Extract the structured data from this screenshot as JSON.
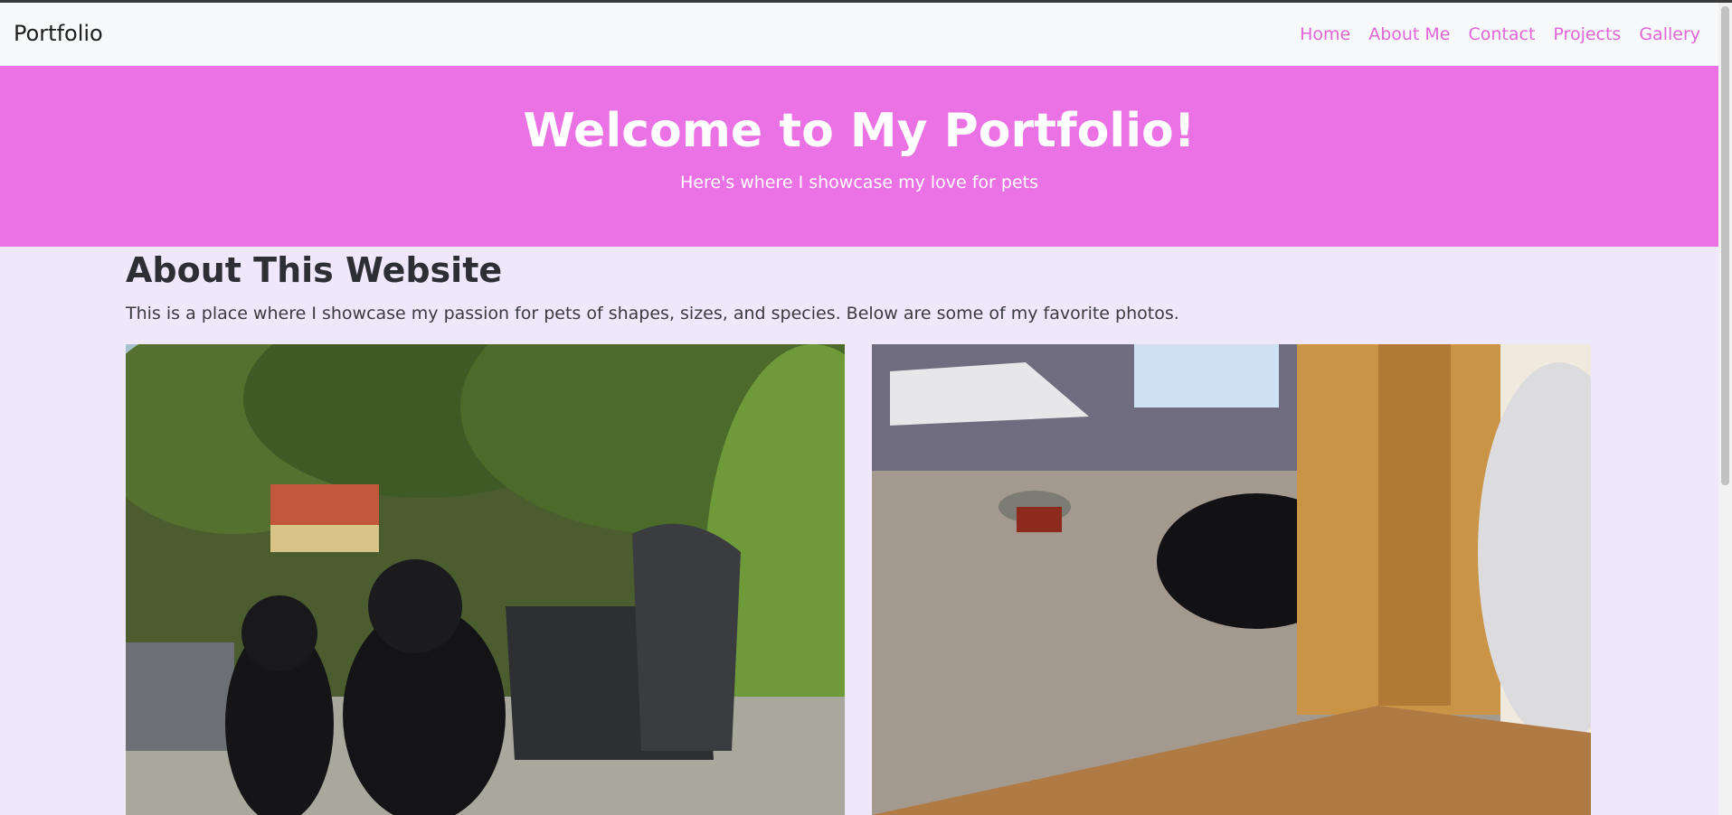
{
  "navbar": {
    "brand": "Portfolio",
    "links": [
      "Home",
      "About Me",
      "Contact",
      "Projects",
      "Gallery"
    ]
  },
  "hero": {
    "title": "Welcome to My Portfolio!",
    "subtitle": "Here's where I showcase my love for pets"
  },
  "about": {
    "title": "About This Website",
    "text": "This is a place where I showcase my passion for pets of shapes, sizes, and species. Below are some of my favorite photos."
  },
  "colors": {
    "hero_bg": "#ea72e4",
    "page_bg": "#efe8fb",
    "nav_link": "#e066d8"
  }
}
